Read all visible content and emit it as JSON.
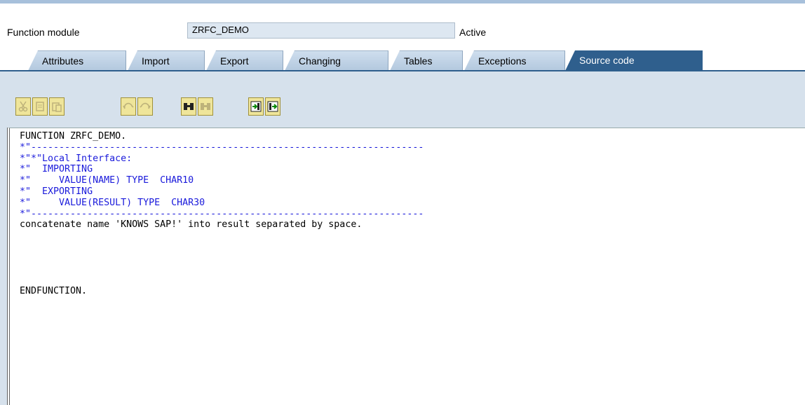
{
  "header": {
    "label": "Function module",
    "name_value": "ZRFC_DEMO",
    "status": "Active"
  },
  "tabs": [
    {
      "label": "Attributes"
    },
    {
      "label": "Import"
    },
    {
      "label": "Export"
    },
    {
      "label": "Changing"
    },
    {
      "label": "Tables"
    },
    {
      "label": "Exceptions"
    },
    {
      "label": "Source code",
      "active": true
    }
  ],
  "toolbar": {
    "buttons": [
      {
        "icon": "cut-icon",
        "enabled": false
      },
      {
        "icon": "copy-icon",
        "enabled": false
      },
      {
        "icon": "paste-icon",
        "enabled": false
      },
      {
        "icon": "undo-icon",
        "enabled": false
      },
      {
        "icon": "redo-icon",
        "enabled": false
      },
      {
        "icon": "find-icon",
        "enabled": true
      },
      {
        "icon": "find-next-icon",
        "enabled": false
      },
      {
        "icon": "upload-icon",
        "enabled": true
      },
      {
        "icon": "download-icon",
        "enabled": true
      }
    ]
  },
  "editor": {
    "lines": [
      {
        "text": "FUNCTION ZRFC_DEMO.",
        "color": "black"
      },
      {
        "text": "*\"----------------------------------------------------------------------",
        "color": "blue"
      },
      {
        "text": "*\"*\"Local Interface:",
        "color": "blue"
      },
      {
        "text": "*\"  IMPORTING",
        "color": "blue"
      },
      {
        "text": "*\"     VALUE(NAME) TYPE  CHAR10",
        "color": "blue"
      },
      {
        "text": "*\"  EXPORTING",
        "color": "blue"
      },
      {
        "text": "*\"     VALUE(RESULT) TYPE  CHAR30",
        "color": "blue"
      },
      {
        "text": "*\"----------------------------------------------------------------------",
        "color": "blue"
      },
      {
        "text": "concatenate name 'KNOWS SAP!' into result separated by space.",
        "color": "black"
      },
      {
        "text": "",
        "color": "black"
      },
      {
        "text": "",
        "color": "black"
      },
      {
        "text": "",
        "color": "black"
      },
      {
        "text": "",
        "color": "black"
      },
      {
        "text": "",
        "color": "black"
      },
      {
        "text": "ENDFUNCTION.",
        "color": "black"
      }
    ]
  },
  "colors": {
    "accent": "#2f5f8d",
    "panel": "#d6e1ec",
    "comment": "#1a1adb"
  }
}
